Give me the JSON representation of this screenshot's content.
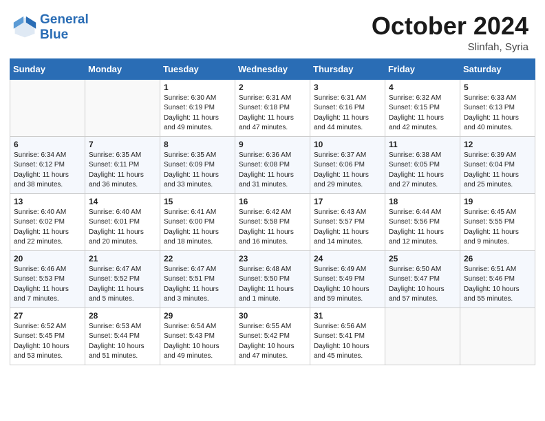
{
  "header": {
    "logo_line1": "General",
    "logo_line2": "Blue",
    "month_title": "October 2024",
    "subtitle": "Slinfah, Syria"
  },
  "days_of_week": [
    "Sunday",
    "Monday",
    "Tuesday",
    "Wednesday",
    "Thursday",
    "Friday",
    "Saturday"
  ],
  "weeks": [
    [
      {
        "day": "",
        "info": ""
      },
      {
        "day": "",
        "info": ""
      },
      {
        "day": "1",
        "info": "Sunrise: 6:30 AM\nSunset: 6:19 PM\nDaylight: 11 hours and 49 minutes."
      },
      {
        "day": "2",
        "info": "Sunrise: 6:31 AM\nSunset: 6:18 PM\nDaylight: 11 hours and 47 minutes."
      },
      {
        "day": "3",
        "info": "Sunrise: 6:31 AM\nSunset: 6:16 PM\nDaylight: 11 hours and 44 minutes."
      },
      {
        "day": "4",
        "info": "Sunrise: 6:32 AM\nSunset: 6:15 PM\nDaylight: 11 hours and 42 minutes."
      },
      {
        "day": "5",
        "info": "Sunrise: 6:33 AM\nSunset: 6:13 PM\nDaylight: 11 hours and 40 minutes."
      }
    ],
    [
      {
        "day": "6",
        "info": "Sunrise: 6:34 AM\nSunset: 6:12 PM\nDaylight: 11 hours and 38 minutes."
      },
      {
        "day": "7",
        "info": "Sunrise: 6:35 AM\nSunset: 6:11 PM\nDaylight: 11 hours and 36 minutes."
      },
      {
        "day": "8",
        "info": "Sunrise: 6:35 AM\nSunset: 6:09 PM\nDaylight: 11 hours and 33 minutes."
      },
      {
        "day": "9",
        "info": "Sunrise: 6:36 AM\nSunset: 6:08 PM\nDaylight: 11 hours and 31 minutes."
      },
      {
        "day": "10",
        "info": "Sunrise: 6:37 AM\nSunset: 6:06 PM\nDaylight: 11 hours and 29 minutes."
      },
      {
        "day": "11",
        "info": "Sunrise: 6:38 AM\nSunset: 6:05 PM\nDaylight: 11 hours and 27 minutes."
      },
      {
        "day": "12",
        "info": "Sunrise: 6:39 AM\nSunset: 6:04 PM\nDaylight: 11 hours and 25 minutes."
      }
    ],
    [
      {
        "day": "13",
        "info": "Sunrise: 6:40 AM\nSunset: 6:02 PM\nDaylight: 11 hours and 22 minutes."
      },
      {
        "day": "14",
        "info": "Sunrise: 6:40 AM\nSunset: 6:01 PM\nDaylight: 11 hours and 20 minutes."
      },
      {
        "day": "15",
        "info": "Sunrise: 6:41 AM\nSunset: 6:00 PM\nDaylight: 11 hours and 18 minutes."
      },
      {
        "day": "16",
        "info": "Sunrise: 6:42 AM\nSunset: 5:58 PM\nDaylight: 11 hours and 16 minutes."
      },
      {
        "day": "17",
        "info": "Sunrise: 6:43 AM\nSunset: 5:57 PM\nDaylight: 11 hours and 14 minutes."
      },
      {
        "day": "18",
        "info": "Sunrise: 6:44 AM\nSunset: 5:56 PM\nDaylight: 11 hours and 12 minutes."
      },
      {
        "day": "19",
        "info": "Sunrise: 6:45 AM\nSunset: 5:55 PM\nDaylight: 11 hours and 9 minutes."
      }
    ],
    [
      {
        "day": "20",
        "info": "Sunrise: 6:46 AM\nSunset: 5:53 PM\nDaylight: 11 hours and 7 minutes."
      },
      {
        "day": "21",
        "info": "Sunrise: 6:47 AM\nSunset: 5:52 PM\nDaylight: 11 hours and 5 minutes."
      },
      {
        "day": "22",
        "info": "Sunrise: 6:47 AM\nSunset: 5:51 PM\nDaylight: 11 hours and 3 minutes."
      },
      {
        "day": "23",
        "info": "Sunrise: 6:48 AM\nSunset: 5:50 PM\nDaylight: 11 hours and 1 minute."
      },
      {
        "day": "24",
        "info": "Sunrise: 6:49 AM\nSunset: 5:49 PM\nDaylight: 10 hours and 59 minutes."
      },
      {
        "day": "25",
        "info": "Sunrise: 6:50 AM\nSunset: 5:47 PM\nDaylight: 10 hours and 57 minutes."
      },
      {
        "day": "26",
        "info": "Sunrise: 6:51 AM\nSunset: 5:46 PM\nDaylight: 10 hours and 55 minutes."
      }
    ],
    [
      {
        "day": "27",
        "info": "Sunrise: 6:52 AM\nSunset: 5:45 PM\nDaylight: 10 hours and 53 minutes."
      },
      {
        "day": "28",
        "info": "Sunrise: 6:53 AM\nSunset: 5:44 PM\nDaylight: 10 hours and 51 minutes."
      },
      {
        "day": "29",
        "info": "Sunrise: 6:54 AM\nSunset: 5:43 PM\nDaylight: 10 hours and 49 minutes."
      },
      {
        "day": "30",
        "info": "Sunrise: 6:55 AM\nSunset: 5:42 PM\nDaylight: 10 hours and 47 minutes."
      },
      {
        "day": "31",
        "info": "Sunrise: 6:56 AM\nSunset: 5:41 PM\nDaylight: 10 hours and 45 minutes."
      },
      {
        "day": "",
        "info": ""
      },
      {
        "day": "",
        "info": ""
      }
    ]
  ]
}
